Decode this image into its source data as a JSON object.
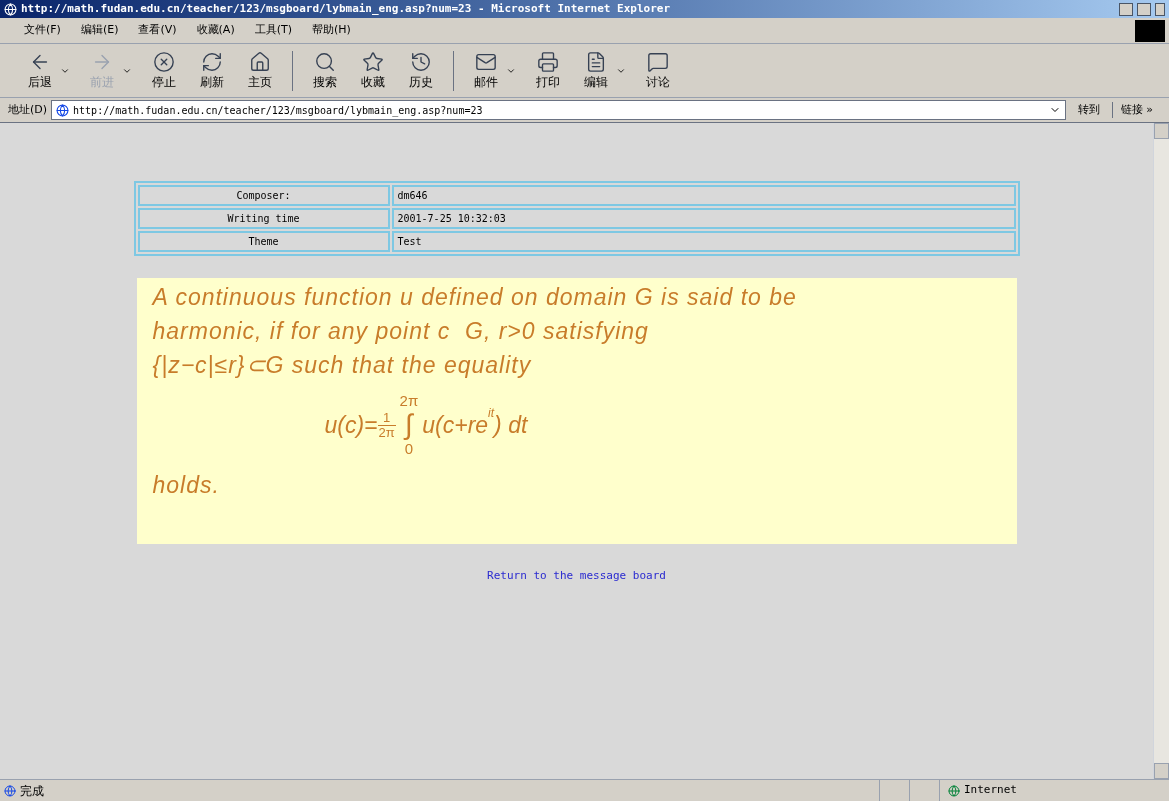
{
  "window": {
    "title": "http://math.fudan.edu.cn/teacher/123/msgboard/lybmain_eng.asp?num=23 - Microsoft Internet Explorer"
  },
  "menu": [
    "文件(F)",
    "编辑(E)",
    "查看(V)",
    "收藏(A)",
    "工具(T)",
    "帮助(H)"
  ],
  "toolbar": [
    {
      "kind": "back",
      "label": "后退",
      "disabled": false,
      "dropdown": true
    },
    {
      "kind": "forward",
      "label": "前进",
      "disabled": true,
      "dropdown": true
    },
    {
      "kind": "stop",
      "label": "停止",
      "disabled": false,
      "dropdown": false
    },
    {
      "kind": "refresh",
      "label": "刷新",
      "disabled": false,
      "dropdown": false
    },
    {
      "kind": "home",
      "label": "主页",
      "disabled": false,
      "dropdown": false
    },
    {
      "kind": "search",
      "label": "搜索",
      "disabled": false,
      "dropdown": false
    },
    {
      "kind": "favorites",
      "label": "收藏",
      "disabled": false,
      "dropdown": false
    },
    {
      "kind": "history",
      "label": "历史",
      "disabled": false,
      "dropdown": false
    },
    {
      "kind": "mail",
      "label": "邮件",
      "disabled": false,
      "dropdown": true
    },
    {
      "kind": "print",
      "label": "打印",
      "disabled": false,
      "dropdown": false
    },
    {
      "kind": "edit",
      "label": "编辑",
      "disabled": false,
      "dropdown": true
    },
    {
      "kind": "discuss",
      "label": "讨论",
      "disabled": false,
      "dropdown": false
    }
  ],
  "address_bar": {
    "label": "地址(D)",
    "value": "http://math.fudan.edu.cn/teacher/123/msgboard/lybmain_eng.asp?num=23",
    "go": "转到",
    "links": "链接 »"
  },
  "info_table": [
    {
      "label": "Composer:",
      "value": "dm646"
    },
    {
      "label": "Writing time",
      "value": "2001-7-25 10:32:03"
    },
    {
      "label": "Theme",
      "value": "Test"
    }
  ],
  "message": {
    "lines": [
      "A continuous function u defined on domain G is said to be",
      "harmonic, if for any point c  G, r>0 satisfying",
      "{|z−c|≤r}⊂G such that the equality"
    ],
    "formula": {
      "left": "u(c)=",
      "numerator": "1",
      "denominator": "2π",
      "upper": "2π",
      "integral": "∫",
      "lower": "0",
      "body": "u(c+re",
      "exponent": "it",
      "tail": ") dt"
    },
    "closing": "holds."
  },
  "return_link": "Return to the message board",
  "status_bar": {
    "text": "完成",
    "zone": "Internet"
  }
}
